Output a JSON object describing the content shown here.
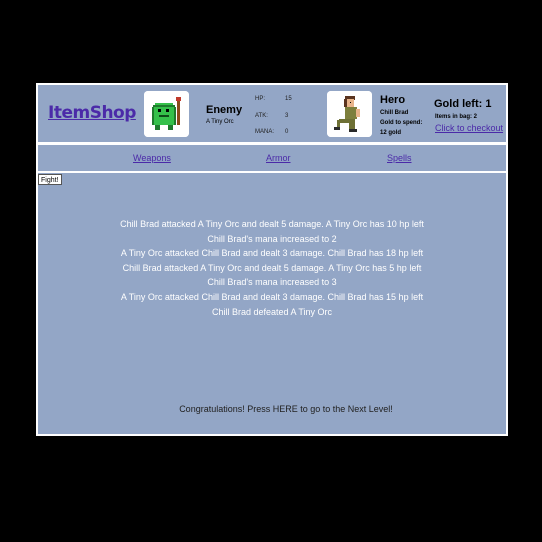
{
  "header": {
    "logo": "ItemShop",
    "enemy": {
      "title": "Enemy",
      "name": "A Tiny Orc",
      "stats": [
        {
          "label": "HP:",
          "value": "15"
        },
        {
          "label": "ATK:",
          "value": "3"
        },
        {
          "label": "MANA:",
          "value": "0"
        }
      ]
    },
    "hero": {
      "title": "Hero",
      "name": "Chill Brad",
      "gold_to_spend_label": "Gold to spend:",
      "gold_amount": "12 gold"
    },
    "gold_left": "Gold left: 1",
    "items_in_bag": "Items in bag: 2",
    "checkout": "Click to checkout"
  },
  "nav": {
    "weapons": "Weapons",
    "armor": "Armor",
    "spells": "Spells"
  },
  "main": {
    "fight_button": "Fight!",
    "log": [
      "Chill Brad attacked A Tiny Orc and dealt 5 damage. A Tiny Orc has 10 hp left",
      "Chill Brad's mana increased to 2",
      "A Tiny Orc attacked Chill Brad and dealt 3 damage. Chill Brad has 18 hp left",
      "Chill Brad attacked A Tiny Orc and dealt 5 damage. A Tiny Orc has 5 hp left",
      "Chill Brad's mana increased to 3",
      "A Tiny Orc attacked Chill Brad and dealt 3 damage. Chill Brad has 15 hp left",
      "Chill Brad defeated A Tiny Orc"
    ],
    "congrats": "Congratulations! Press HERE to go to the Next Level!"
  },
  "icons": {
    "enemy": "orc-sprite-icon",
    "hero": "hero-sprite-icon"
  }
}
